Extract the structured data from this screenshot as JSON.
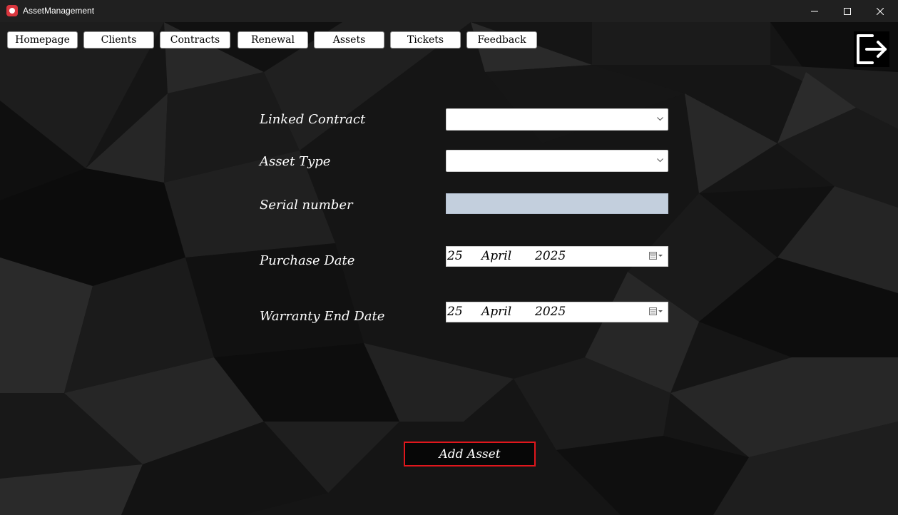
{
  "window": {
    "title": "AssetManagement",
    "controls": {
      "minimize": "minimize-icon",
      "maximize": "maximize-icon",
      "close": "close-icon"
    }
  },
  "nav": {
    "items": [
      "Homepage",
      "Clients",
      "Contracts",
      "Renewal",
      "Assets",
      "Tickets",
      "Feedback"
    ],
    "logout_icon": "logout-icon"
  },
  "form": {
    "linked_contract": {
      "label": "Linked Contract",
      "value": ""
    },
    "asset_type": {
      "label": "Asset Type",
      "value": ""
    },
    "serial_number": {
      "label": "Serial number",
      "value": ""
    },
    "purchase_date": {
      "label": "Purchase Date",
      "day": "25",
      "month": "April",
      "year": "2025"
    },
    "warranty_end_date": {
      "label": "Warranty End Date",
      "day": "25",
      "month": "April",
      "year": "2025"
    },
    "submit_label": "Add Asset"
  },
  "colors": {
    "titlebar": "#202020",
    "background": "#141414",
    "serial_field": "#c3cfdd",
    "submit_border": "#e0161c"
  }
}
